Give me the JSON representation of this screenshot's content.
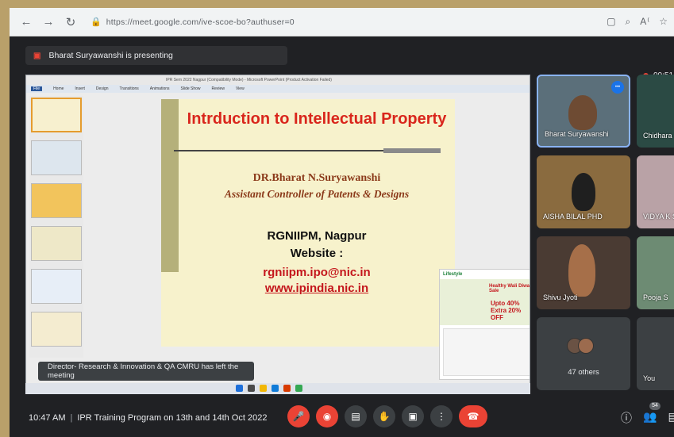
{
  "browser": {
    "url": "https://meet.google.com/ive-scoe-bo?authuser=0",
    "right_icons": [
      "reader-icon",
      "zoom-icon",
      "read-aloud-icon",
      "favorites-icon"
    ]
  },
  "presenting": {
    "text": "Bharat Suryawanshi is presenting"
  },
  "recording": {
    "time": "00:51"
  },
  "shared_screen": {
    "ppt_window_title": "IPR Sem 2022 Nagpur (Compatibility Mode) - Microsoft PowerPoint (Product Activation Failed)",
    "ribbon_tabs": [
      "File",
      "Home",
      "Insert",
      "Design",
      "Transitions",
      "Animations",
      "Slide Show",
      "Review",
      "View"
    ],
    "slide": {
      "title": "Intrduction to Intellectual Property",
      "name": "DR.Bharat N.Suryawanshi",
      "role": "Assistant Controller of Patents & Designs",
      "org": "RGNIIPM, Nagpur",
      "website_label": "Website :",
      "email": "rgniipm.ipo@nic.in",
      "site": "www.ipindia.nic.in"
    },
    "ad": {
      "brand": "Lifestyle",
      "line1": "Healthy Wali Diwali Sale",
      "offer": "Upto 40% Extra 20% OFF"
    }
  },
  "toast": {
    "text": "Director- Research & Innovation & QA CMRU has left the meeting"
  },
  "participants": [
    {
      "name": "Bharat Suryawanshi",
      "active": true
    },
    {
      "name": "Chidhara"
    },
    {
      "name": "AISHA BILAL PHD"
    },
    {
      "name": "VIDYA K S"
    },
    {
      "name": "Shivu Jyoti"
    },
    {
      "name": "Pooja S"
    },
    {
      "name": "47 others"
    },
    {
      "name": "You"
    }
  ],
  "bottom_bar": {
    "time": "10:47 AM",
    "meeting_title": "IPR Training Program on 13th and 14th Oct 2022",
    "participant_badge": "54",
    "colors": {
      "danger": "#ea4335",
      "neutral": "#3c4043"
    }
  }
}
